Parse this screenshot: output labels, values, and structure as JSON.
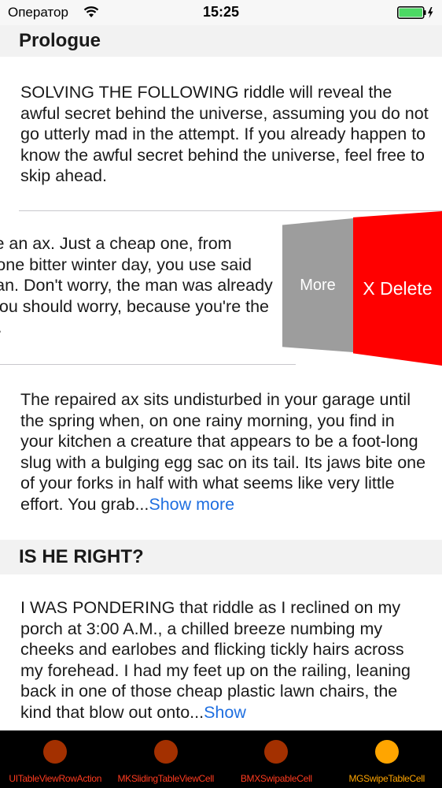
{
  "status_bar": {
    "carrier": "Оператор",
    "time": "15:25",
    "wifi_icon": "wifi-icon",
    "battery_icon": "battery-charging-icon",
    "battery_color": "#4cd964"
  },
  "sections": [
    {
      "header": "Prologue",
      "cells": [
        {
          "text": "SOLVING THE FOLLOWING riddle will reveal the awful secret behind the universe, assuming you do not go utterly mad in the attempt. If you already happen to know the awful secret behind the universe, feel free to skip ahead."
        },
        {
          "text": "Let's say you have an ax. Just a cheap one, from Home Depot. On one bitter winter day, you use said ax to behead a man. Don't worry, the man was already dead. Or maybe you should worry, because you're the one who shot him.",
          "swiped": true,
          "actions": {
            "more": "More",
            "delete": "X Delete"
          }
        },
        {
          "text": "The repaired ax sits undisturbed in your garage until the spring when, on one rainy morning, you find in your kitchen a creature that appears to be a foot-long slug with a bulging egg sac on its tail. Its jaws bite one of your forks in half with what seems like very little effort. You grab...",
          "show_more": "Show more"
        }
      ]
    },
    {
      "header": "IS HE RIGHT?",
      "cells": [
        {
          "text": "I WAS PONDERING that riddle as I reclined on my porch at 3:00 A.M., a chilled breeze numbing my cheeks and earlobes and flicking tickly hairs across my forehead. I had my feet up on the railing, leaning back in one of those cheap plastic lawn chairs, the kind that blow out onto...",
          "show_more": "Show"
        }
      ]
    }
  ],
  "colors": {
    "link": "#1f6fe0",
    "more_action": "#9d9d9d",
    "delete_action": "#ff0000",
    "tab_inactive": "#a33000",
    "tab_active": "#ffa500"
  },
  "tabs": [
    {
      "label": "UITableViewRowAction",
      "active": false
    },
    {
      "label": "MKSlidingTableViewCell",
      "active": false
    },
    {
      "label": "BMXSwipableCell",
      "active": false
    },
    {
      "label": "MGSwipeTableCell",
      "active": true
    }
  ]
}
